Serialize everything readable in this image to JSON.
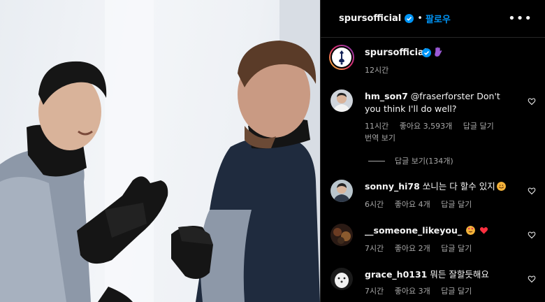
{
  "header": {
    "username": "spursofficial",
    "dot": "•",
    "follow_label": "팔로우",
    "more_label": "•••"
  },
  "caption": {
    "username": "spursofficial",
    "time": "12시간"
  },
  "comments": [
    {
      "username": "hm_son7",
      "text": "@fraserforster Don't you think I'll do well?",
      "time": "11시간",
      "likes": "좋아요 3,593개",
      "reply_label": "답글 달기",
      "translate_label": "번역 보기",
      "view_replies_label": "답글 보기(134개)"
    },
    {
      "username": "sonny_hi78",
      "text": "쏘니는 다 할수 있지",
      "time": "6시간",
      "likes": "좋아요 4개",
      "reply_label": "답글 달기"
    },
    {
      "username": "__someone_likeyou_",
      "text": "",
      "time": "7시간",
      "likes": "좋아요 2개",
      "reply_label": "답글 달기"
    },
    {
      "username": "grace_h0131",
      "text": "뭐든 잘할듯해요",
      "time": "7시간",
      "likes": "좋아요 3개",
      "reply_label": "답글 달기"
    }
  ],
  "colors": {
    "link": "#0095f6",
    "verified": "#0095f6",
    "secondary_text": "#a8a8a8"
  },
  "icons": [
    "verified-badge-icon",
    "purple-hand-icon",
    "heart-outline-icon",
    "more-icon",
    "smile-emoji-icon",
    "heart-eyes-emoji-icon",
    "red-heart-emoji-icon"
  ]
}
